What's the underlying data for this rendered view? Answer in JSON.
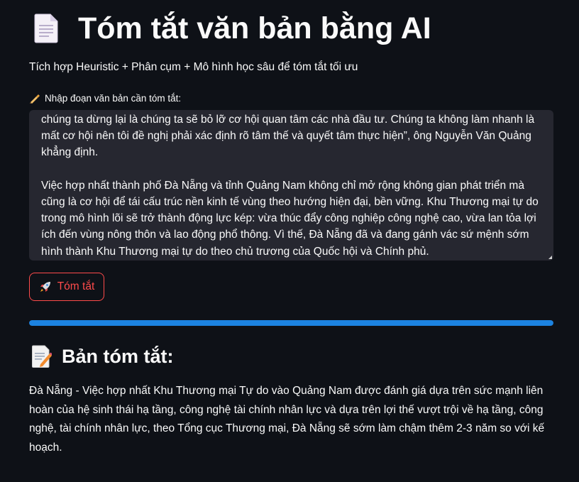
{
  "header": {
    "title": "Tóm tắt văn bản bằng AI",
    "icon": "document-icon",
    "subtitle": "Tích hợp Heuristic + Phân cụm + Mô hình học sâu để tóm tắt tối ưu"
  },
  "input": {
    "label": "Nhập đoạn văn bản cần tóm tắt:",
    "label_icon": "writing-hand-icon",
    "value": "chúng ta dừng lại là chúng ta sẽ bỏ lỡ cơ hội quan tâm các nhà đầu tư. Chúng ta không làm nhanh là\nmất cơ hội nên tôi đề nghị phải xác định rõ tâm thế và quyết tâm thực hiện”, ông Nguyễn Văn Quảng\nkhẳng định.\n\nViệc hợp nhất thành phố Đà Nẵng và tỉnh Quảng Nam không chỉ mở rộng không gian phát triển mà\ncũng là cơ hội để tái cấu trúc nền kinh tế vùng theo hướng hiện đại, bền vững. Khu Thương mại tự do\ntrong mô hình lõi sẽ trở thành động lực kép: vừa thúc đẩy công nghiệp công nghệ cao, vừa lan tỏa lợi\ních đến vùng nông thôn và lao động phổ thông. Vì thế, Đà Nẵng đã và đang gánh vác sứ mệnh sớm\nhình thành Khu Thương mại tự do theo chủ trương của Quốc hội và Chính phủ."
  },
  "button": {
    "label": "Tóm tắt",
    "icon": "rocket-icon"
  },
  "progress": {
    "value": 1.0
  },
  "summary": {
    "heading": "Bản tóm tắt:",
    "icon": "memo-icon",
    "text": "Đà Nẵng - Việc hợp nhất Khu Thương mại Tự do vào Quảng Nam được đánh giá dựa trên sức mạnh liên hoàn của hệ sinh thái hạ tầng, công nghệ tài chính nhân lực và dựa trên lợi thế vượt trội về hạ tầng, công nghệ, tài chính nhân lực, theo Tổng cục Thương mại, Đà Nẵng sẽ sớm làm chậm thêm 2-3 năm so với kế hoạch."
  },
  "colors": {
    "background": "#0e1117",
    "textarea_background": "#262730",
    "accent": "#ff4b4b",
    "progress": "#1c83e1"
  }
}
